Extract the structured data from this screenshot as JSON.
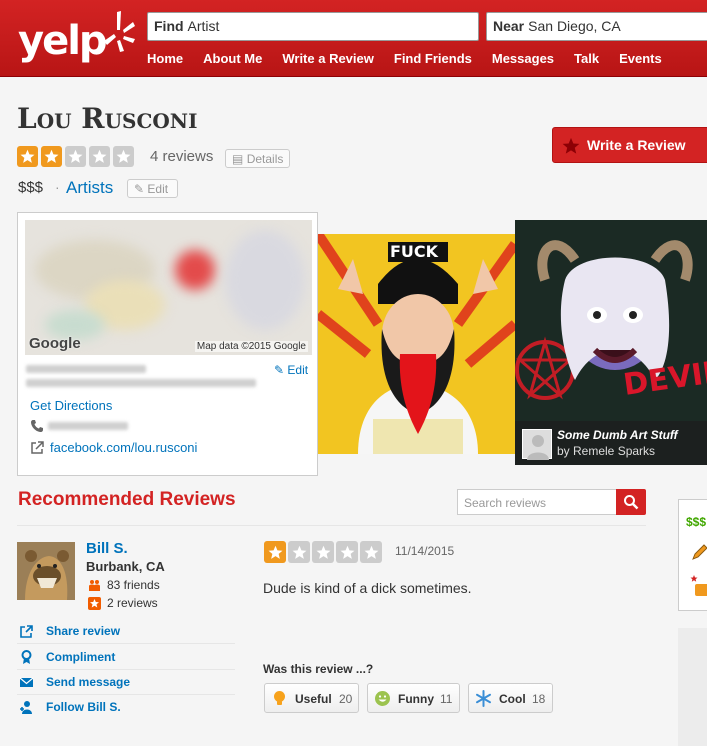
{
  "header": {
    "logo_text": "yelp",
    "find_label": "Find",
    "find_value": "Artist",
    "near_label": "Near",
    "near_value": "San Diego, CA",
    "nav": [
      "Home",
      "About Me",
      "Write a Review",
      "Find Friends",
      "Messages",
      "Talk",
      "Events"
    ]
  },
  "business": {
    "name": "Lou Rusconi",
    "rating": 2,
    "review_count": "4 reviews",
    "details_label": "Details",
    "price": "$$$",
    "separator": "·",
    "category": "Artists",
    "edit_label": "Edit",
    "write_review_label": "Write a Review"
  },
  "map_card": {
    "google_label": "Google",
    "map_data": "Map data ©2015 Google",
    "edit_label": "Edit",
    "directions_label": "Get Directions",
    "facebook_link": "facebook.com/lou.rusconi"
  },
  "photos": {
    "caption_title": "Some Dumb Art Stuff",
    "caption_by": "by Remele Sparks"
  },
  "reviews": {
    "section_title": "Recommended Reviews",
    "search_placeholder": "Search reviews",
    "review": {
      "user_name": "Bill S.",
      "user_location": "Burbank, CA",
      "friends": "83 friends",
      "reviews": "2 reviews",
      "rating": 1,
      "date": "11/14/2015",
      "text": "Dude is kind of a dick sometimes.",
      "helpful_prompt": "Was this review ...?",
      "votes": [
        {
          "label": "Useful",
          "count": "20"
        },
        {
          "label": "Funny",
          "count": "11"
        },
        {
          "label": "Cool",
          "count": "18"
        }
      ]
    },
    "actions": [
      "Share review",
      "Compliment",
      "Send message",
      "Follow Bill S."
    ]
  },
  "side_panel": {
    "price": "$$$"
  },
  "colors": {
    "brand_red": "#d32323",
    "link_blue": "#0073bb",
    "star_orange": "#f0991e"
  }
}
